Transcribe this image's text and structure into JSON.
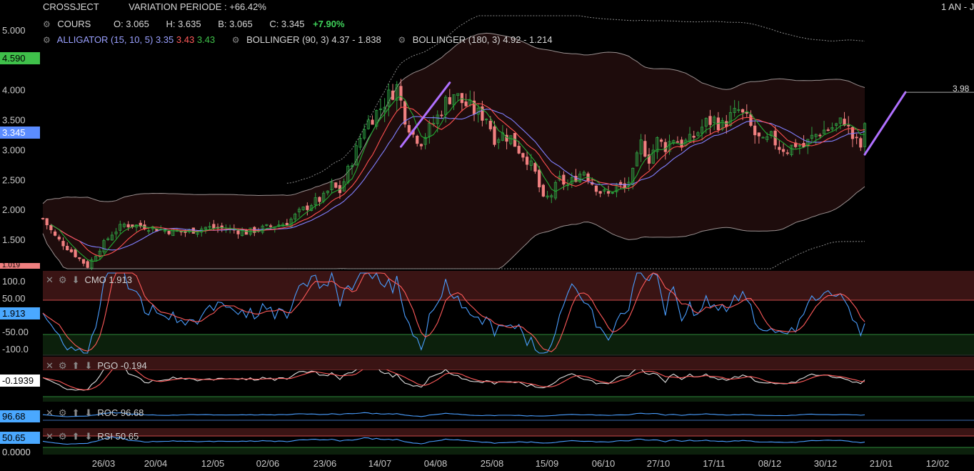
{
  "header": {
    "symbol": "CROSSJECT",
    "variation": "VARIATION PERIODE : +66.42%",
    "range": "1 AN - J"
  },
  "quote": {
    "label": "COURS",
    "o": "O: 3.065",
    "h": "H: 3.635",
    "b": "B: 3.065",
    "c": "C: 3.345",
    "change": "+7.90%"
  },
  "indicators": {
    "alligator_label": "ALLIGATOR (15, 10, 5)",
    "alligator_v1": "3.35",
    "alligator_v2": "3.43",
    "alligator_v3": "3.43",
    "boll90": "BOLLINGER (90, 3) 4.37 - 1.838",
    "boll180": "BOLLINGER (180, 3) 4.92 - 1.214"
  },
  "tags": {
    "high": "4.590",
    "last": "3.345",
    "low": "1.019",
    "cmo": "1.913",
    "pgo": "-0.1939",
    "roc": "96.68",
    "rsi": "50.65",
    "rsi_low": "0.0000"
  },
  "trend_label": "3.98",
  "panels": {
    "cmo": "CMO 1.913",
    "pgo": "PGO -0.194",
    "roc": "ROC 96.68",
    "rsi": "RSI 50.65"
  },
  "colors": {
    "up": "#2ea043",
    "down": "#f08080",
    "alligator_jaw": "#8080ff",
    "alligator_teeth": "#ff5050",
    "alligator_lips": "#22aa33",
    "trend": "#b070ff",
    "osc_main": "#4a9eff",
    "osc_signal": "#ff5a5a"
  },
  "chart_data": {
    "type": "candlestick",
    "y_ticks": [
      "5.000",
      "4.000",
      "3.500",
      "3.000",
      "2.500",
      "2.000",
      "1.500"
    ],
    "x_ticks": [
      "26/03",
      "20/04",
      "12/05",
      "02/06",
      "23/06",
      "14/07",
      "04/08",
      "25/08",
      "15/09",
      "06/10",
      "27/10",
      "17/11",
      "08/12",
      "30/12",
      "21/01",
      "12/02"
    ],
    "ylim": [
      1.0,
      5.2
    ],
    "close_path": [
      [
        0,
        1.85
      ],
      [
        3,
        1.55
      ],
      [
        7,
        1.3
      ],
      [
        11,
        1.05
      ],
      [
        14,
        1.35
      ],
      [
        17,
        1.6
      ],
      [
        20,
        1.75
      ],
      [
        25,
        1.72
      ],
      [
        30,
        1.65
      ],
      [
        35,
        1.62
      ],
      [
        40,
        1.7
      ],
      [
        45,
        1.68
      ],
      [
        50,
        1.62
      ],
      [
        55,
        1.7
      ],
      [
        60,
        1.78
      ],
      [
        63,
        1.95
      ],
      [
        66,
        2.1
      ],
      [
        69,
        2.2
      ],
      [
        71,
        2.4
      ],
      [
        73,
        2.3
      ],
      [
        75,
        2.65
      ],
      [
        77,
        3.0
      ],
      [
        79,
        3.4
      ],
      [
        81,
        3.55
      ],
      [
        83,
        3.7
      ],
      [
        85,
        3.9
      ],
      [
        87,
        4.05
      ],
      [
        89,
        3.55
      ],
      [
        91,
        3.25
      ],
      [
        93,
        3.15
      ],
      [
        95,
        3.35
      ],
      [
        97,
        3.55
      ],
      [
        99,
        3.8
      ],
      [
        101,
        3.95
      ],
      [
        103,
        3.8
      ],
      [
        105,
        3.7
      ],
      [
        107,
        3.6
      ],
      [
        109,
        3.55
      ],
      [
        111,
        3.2
      ],
      [
        113,
        3.25
      ],
      [
        115,
        3.2
      ],
      [
        117,
        3.0
      ],
      [
        119,
        2.85
      ],
      [
        121,
        2.6
      ],
      [
        123,
        2.15
      ],
      [
        125,
        2.25
      ],
      [
        127,
        2.5
      ],
      [
        129,
        2.4
      ],
      [
        131,
        2.55
      ],
      [
        133,
        2.65
      ],
      [
        135,
        2.45
      ],
      [
        137,
        2.3
      ],
      [
        139,
        2.25
      ],
      [
        141,
        2.4
      ],
      [
        143,
        2.35
      ],
      [
        145,
        2.6
      ],
      [
        147,
        3.1
      ],
      [
        149,
        2.85
      ],
      [
        151,
        3.15
      ],
      [
        153,
        3.05
      ],
      [
        155,
        3.2
      ],
      [
        157,
        3.1
      ],
      [
        159,
        3.15
      ],
      [
        161,
        3.3
      ],
      [
        163,
        3.45
      ],
      [
        165,
        3.5
      ],
      [
        167,
        3.4
      ],
      [
        169,
        3.55
      ],
      [
        171,
        3.65
      ],
      [
        173,
        3.5
      ],
      [
        175,
        3.25
      ],
      [
        177,
        3.1
      ],
      [
        179,
        3.2
      ],
      [
        181,
        3.05
      ],
      [
        183,
        3.0
      ],
      [
        185,
        3.1
      ],
      [
        187,
        3.05
      ],
      [
        189,
        3.2
      ],
      [
        191,
        3.3
      ],
      [
        193,
        3.35
      ],
      [
        195,
        3.4
      ],
      [
        197,
        3.5
      ],
      [
        199,
        3.2
      ],
      [
        201,
        3.05
      ],
      [
        202,
        3.345
      ]
    ],
    "series": [
      {
        "name": "ALLIGATOR (15, 10, 5)",
        "values": [
          "3.35",
          "3.43",
          "3.43"
        ]
      },
      {
        "name": "BOLLINGER (90, 3)",
        "values": [
          "4.37",
          "1.838"
        ]
      },
      {
        "name": "BOLLINGER (180, 3)",
        "values": [
          "4.92",
          "1.214"
        ]
      }
    ],
    "trendlines": [
      {
        "x0": 88,
        "y0": 3.05,
        "x1": 100,
        "y1": 4.12
      },
      {
        "x0": 202,
        "y0": 2.92,
        "x1": 212,
        "y1": 3.96
      }
    ],
    "oscillators": {
      "cmo": {
        "last": 1.913,
        "upper": 50,
        "lower": -50,
        "ticks": [
          "100.0",
          "50.00",
          "-50.00",
          "-100.0"
        ]
      },
      "pgo": {
        "last": -0.194
      },
      "roc": {
        "last": 96.68
      },
      "rsi": {
        "last": 50.65
      }
    }
  }
}
